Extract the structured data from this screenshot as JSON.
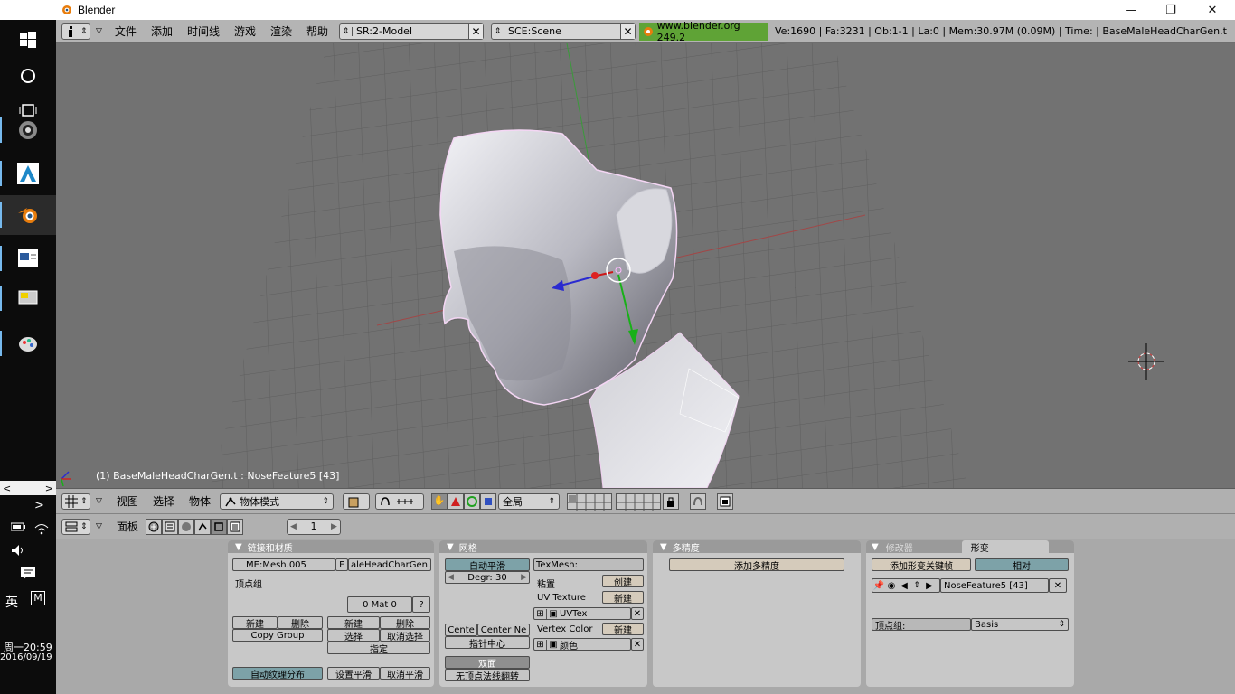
{
  "window": {
    "title": "Blender",
    "minimize": "—",
    "maximize": "❐",
    "close": "✕"
  },
  "taskbar": {
    "time": "周一20:59",
    "date": "2016/09/19",
    "ime1": "英",
    "ime2": "M",
    "prev": "<",
    "next": ">",
    "expand": ">"
  },
  "header": {
    "menus": [
      "文件",
      "添加",
      "时间线",
      "游戏",
      "渲染",
      "帮助"
    ],
    "screen": "SR:2-Model",
    "scene": "SCE:Scene",
    "url": "www.blender.org 249.2",
    "stats": "Ve:1690 | Fa:3231 | Ob:1-1 | La:0  | Mem:30.97M (0.09M)  | Time: | BaseMaleHeadCharGen.t"
  },
  "viewport": {
    "info": "(1) BaseMaleHeadCharGen.t : NoseFeature5 [43]"
  },
  "vp_toolbar": {
    "menus": [
      "视图",
      "选择",
      "物体"
    ],
    "mode": "物体模式",
    "orientation": "全局"
  },
  "btn_header": {
    "label": "面板",
    "frame": "1"
  },
  "panels": {
    "link": {
      "title": "链接和材质",
      "mesh": "ME:Mesh.005",
      "f": "F",
      "object": "aleHeadCharGen.t",
      "vgroup": "顶点组",
      "mat": "0 Mat 0",
      "q": "?",
      "new1": "新建",
      "del1": "删除",
      "copy_group": "Copy Group",
      "new2": "新建",
      "del2": "删除",
      "select": "选择",
      "deselect": "取消选择",
      "assign": "指定",
      "autotex": "自动纹理分布",
      "setsmooth": "设置平滑",
      "setsolid": "取消平滑"
    },
    "mesh": {
      "title": "网格",
      "autosmooth": "自动平滑",
      "degr": "Degr: 30",
      "texmesh": "TexMesh:",
      "sticky": "粘置",
      "create": "创建",
      "uvtex": "UV Texture",
      "new_uv": "新建",
      "uvtex_name": "UVTex",
      "vcol": "Vertex Color",
      "new_vc": "新建",
      "vcol_name": "颜色",
      "center": "Cente",
      "center_new": "Center Ne",
      "center_cursor": "指针中心",
      "double": "双面",
      "nonormal": "无顶点法线翻转"
    },
    "multires": {
      "title": "多精度",
      "add": "添加多精度"
    },
    "shape": {
      "tab1": "修改器",
      "tab2": "形变",
      "add_key": "添加形变关键帧",
      "relative": "相对",
      "key": "NoseFeature5 [43]",
      "vgroup_label": "顶点组:",
      "basis": "Basis"
    }
  },
  "colors": {
    "url_bg": "#5fa336",
    "header": "#b4b4b4",
    "viewport": "#727272",
    "button_area": "#a9a9a9"
  }
}
